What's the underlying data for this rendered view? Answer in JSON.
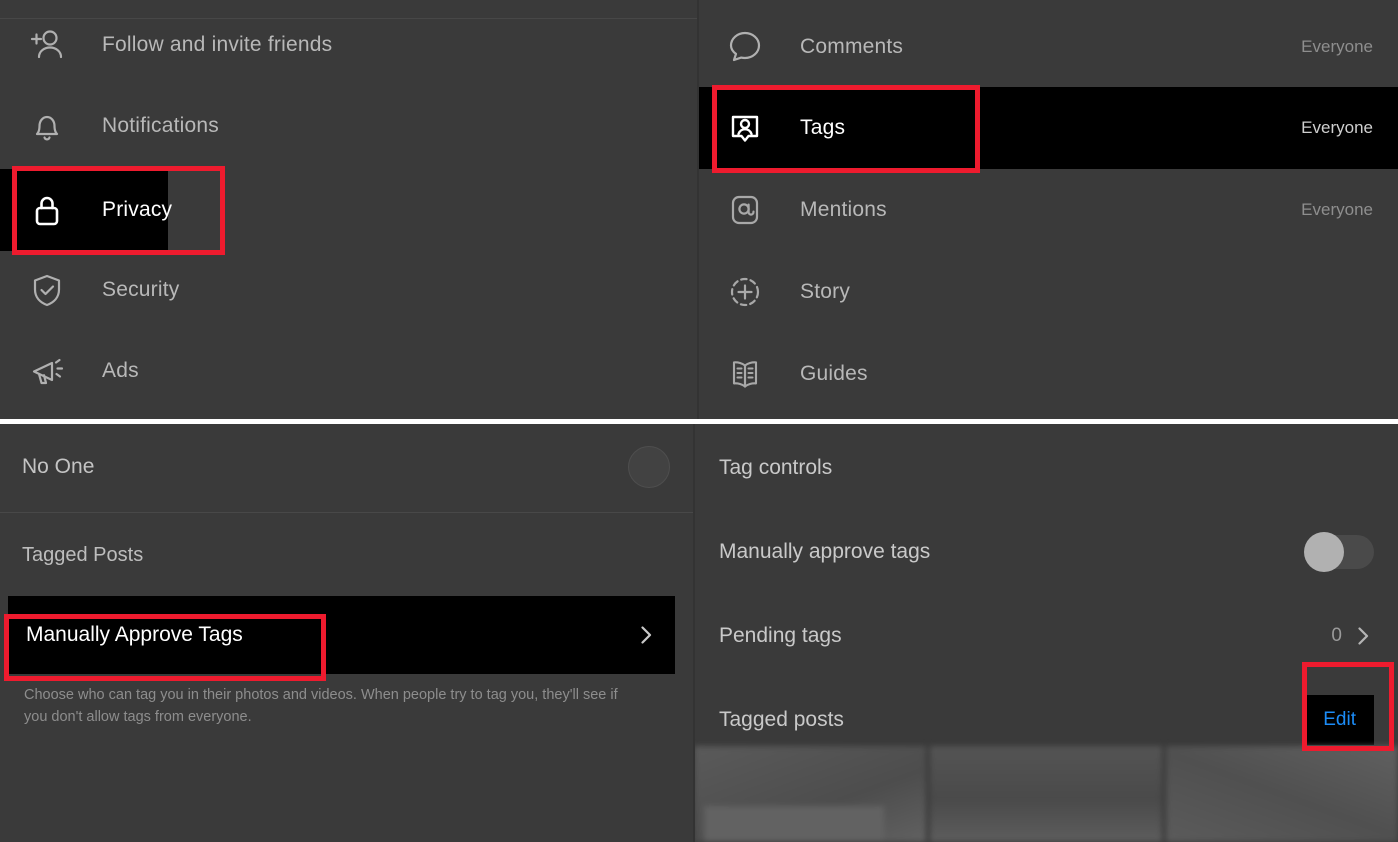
{
  "app": {
    "theme": "dark",
    "accent_red": "#ee1b2e",
    "link_blue": "#1c8cf7",
    "highlight_black": "#000000",
    "panel_bg": "#3a3a3a"
  },
  "settings_menu": {
    "items": [
      {
        "label": "Follow and invite friends",
        "icon": "person-add-icon",
        "active": false
      },
      {
        "label": "Notifications",
        "icon": "bell-icon",
        "active": false
      },
      {
        "label": "Privacy",
        "icon": "lock-icon",
        "active": true
      },
      {
        "label": "Security",
        "icon": "shield-check-icon",
        "active": false
      },
      {
        "label": "Ads",
        "icon": "megaphone-icon",
        "active": false
      }
    ]
  },
  "privacy_menu": {
    "items": [
      {
        "label": "Comments",
        "icon": "comment-bubble-icon",
        "value": "Everyone",
        "active": false
      },
      {
        "label": "Tags",
        "icon": "tag-card-icon",
        "value": "Everyone",
        "active": true
      },
      {
        "label": "Mentions",
        "icon": "at-mention-icon",
        "value": "Everyone",
        "active": false
      },
      {
        "label": "Story",
        "icon": "story-plus-icon",
        "value": "",
        "active": false
      },
      {
        "label": "Guides",
        "icon": "guides-book-icon",
        "value": "",
        "active": false
      }
    ]
  },
  "tags_detail": {
    "no_one_option": "No One",
    "section_title": "Tagged Posts",
    "manually_approve_row": "Manually Approve Tags",
    "helper_text": "Choose who can tag you in their photos and videos. When people try to tag you, they'll see if you don't allow tags from everyone.",
    "chevron_icon": "chevron-right-icon"
  },
  "tag_controls": {
    "section_title": "Tag controls",
    "manually_approve_label": "Manually approve tags",
    "manually_approve_state": "off",
    "pending_tags_label": "Pending tags",
    "pending_tags_count": "0",
    "tagged_posts_label": "Tagged posts",
    "edit_button": "Edit",
    "chevron_icon": "chevron-right-icon"
  }
}
